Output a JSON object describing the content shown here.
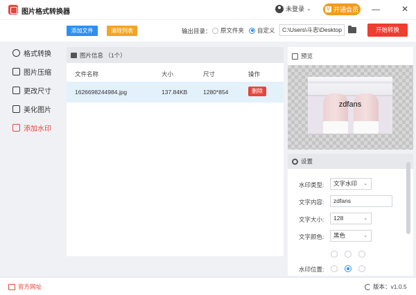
{
  "app": {
    "title": "图片格式转换器"
  },
  "header": {
    "user_label": "未登录",
    "vip_label": "开通会员",
    "vip_icon": "V"
  },
  "window_controls": {
    "minimize": "—",
    "close": "✕"
  },
  "toolbar": {
    "add_file": "添加文件",
    "clear_list": "清除列表",
    "output_label": "输出目录：",
    "option_original": "原文件夹",
    "option_custom": "自定义",
    "selected_option": "自定义",
    "path_value": "C:\\Users\\斗志\\Desktop",
    "start": "开始转换"
  },
  "sidebar": {
    "items": [
      {
        "label": "格式转换",
        "active": false
      },
      {
        "label": "图片压缩",
        "active": false
      },
      {
        "label": "更改尺寸",
        "active": false
      },
      {
        "label": "美化图片",
        "active": false
      },
      {
        "label": "添加水印",
        "active": true
      }
    ]
  },
  "file_panel": {
    "title": "图片信息 （1个）",
    "columns": [
      "文件名称",
      "大小",
      "尺寸",
      "操作"
    ],
    "rows": [
      {
        "name": "1626698244984.jpg",
        "size": "137.84KB",
        "dimensions": "1280*854",
        "action": "删除"
      }
    ]
  },
  "preview": {
    "title": "预览",
    "watermark_text": "zdfans"
  },
  "settings": {
    "title": "设置",
    "type_label": "水印类型:",
    "type_value": "文字水印",
    "content_label": "文字内容:",
    "content_value": "zdfans",
    "size_label": "文字大小:",
    "size_value": "128",
    "color_label": "文字颜色:",
    "color_value": "黑色",
    "position_label": "水印位置:",
    "position_selected": 4
  },
  "footer": {
    "site_link": "官方网址",
    "version": "版本：v1.0.5"
  },
  "colors": {
    "accent_red": "#ef3d2f",
    "accent_blue": "#2e8ff0",
    "accent_orange": "#f4a523"
  }
}
